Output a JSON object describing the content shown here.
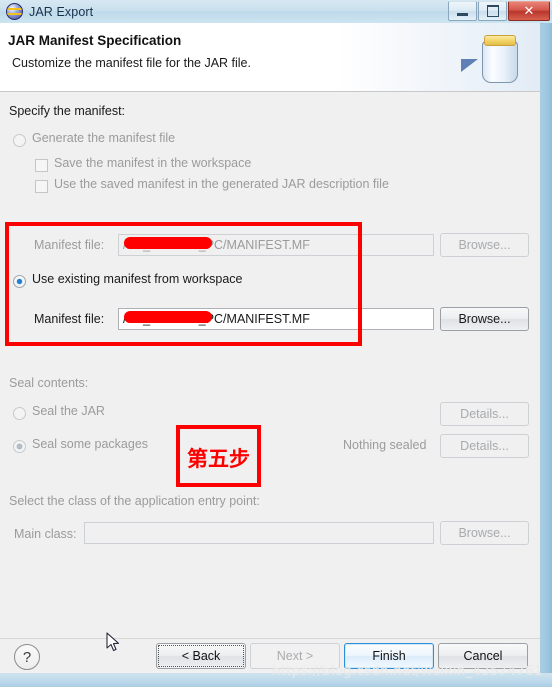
{
  "window": {
    "title": "JAR Export",
    "icon": "eclipse-jar-icon",
    "controls": {
      "minimize": "minimize-button",
      "maximize": "maximize-button",
      "close": "✕"
    }
  },
  "header": {
    "title": "JAR Manifest Specification",
    "subtitle": "Customize the manifest file for the JAR file.",
    "icon": "jar-banner-icon"
  },
  "manifest_section": {
    "group_label": "Specify the manifest:",
    "generate_option": {
      "label": "Generate the manifest file",
      "selected": false,
      "enabled": false
    },
    "save_in_workspace": {
      "label": "Save the manifest in the workspace",
      "checked": false,
      "enabled": false
    },
    "use_saved_manifest": {
      "label": "Use the saved manifest in the generated JAR description file",
      "checked": false,
      "enabled": false
    },
    "generate_manifest_file_row": {
      "label": "Manifest file:",
      "value": "/GL_AutoTest_PC/MANIFEST.MF",
      "browse_label": "Browse...",
      "enabled": false
    },
    "use_existing_option": {
      "label": "Use existing manifest from workspace",
      "selected": true,
      "enabled": true
    },
    "existing_manifest_file_row": {
      "label": "Manifest file:",
      "value": "/GL_AutoTest_PC/MANIFEST.MF",
      "browse_label": "Browse...",
      "enabled": true
    }
  },
  "seal_section": {
    "group_label": "Seal contents:",
    "seal_jar": {
      "label": "Seal the JAR",
      "selected": false,
      "enabled": false,
      "details_label": "Details..."
    },
    "seal_some_packages": {
      "label": "Seal some packages",
      "selected": true,
      "enabled": false,
      "status": "Nothing sealed",
      "details_label": "Details..."
    }
  },
  "entry_point_section": {
    "group_label": "Select the class of the application entry point:",
    "main_class": {
      "label": "Main class:",
      "value": "",
      "browse_label": "Browse...",
      "enabled": false
    }
  },
  "footer": {
    "help_label": "?",
    "back_label": "< Back",
    "next_label": "Next >",
    "finish_label": "Finish",
    "cancel_label": "Cancel"
  },
  "annotations": {
    "manifest_highlight": "red-rectangle-manifest-area",
    "step_label": "第五步"
  },
  "watermark": "https://blog.csdn.net/weixin_43574761",
  "colors": {
    "annotation_red": "#fe0000",
    "accent_blue": "#1e7fd4",
    "dialog_bg": "#f0f0f0"
  }
}
